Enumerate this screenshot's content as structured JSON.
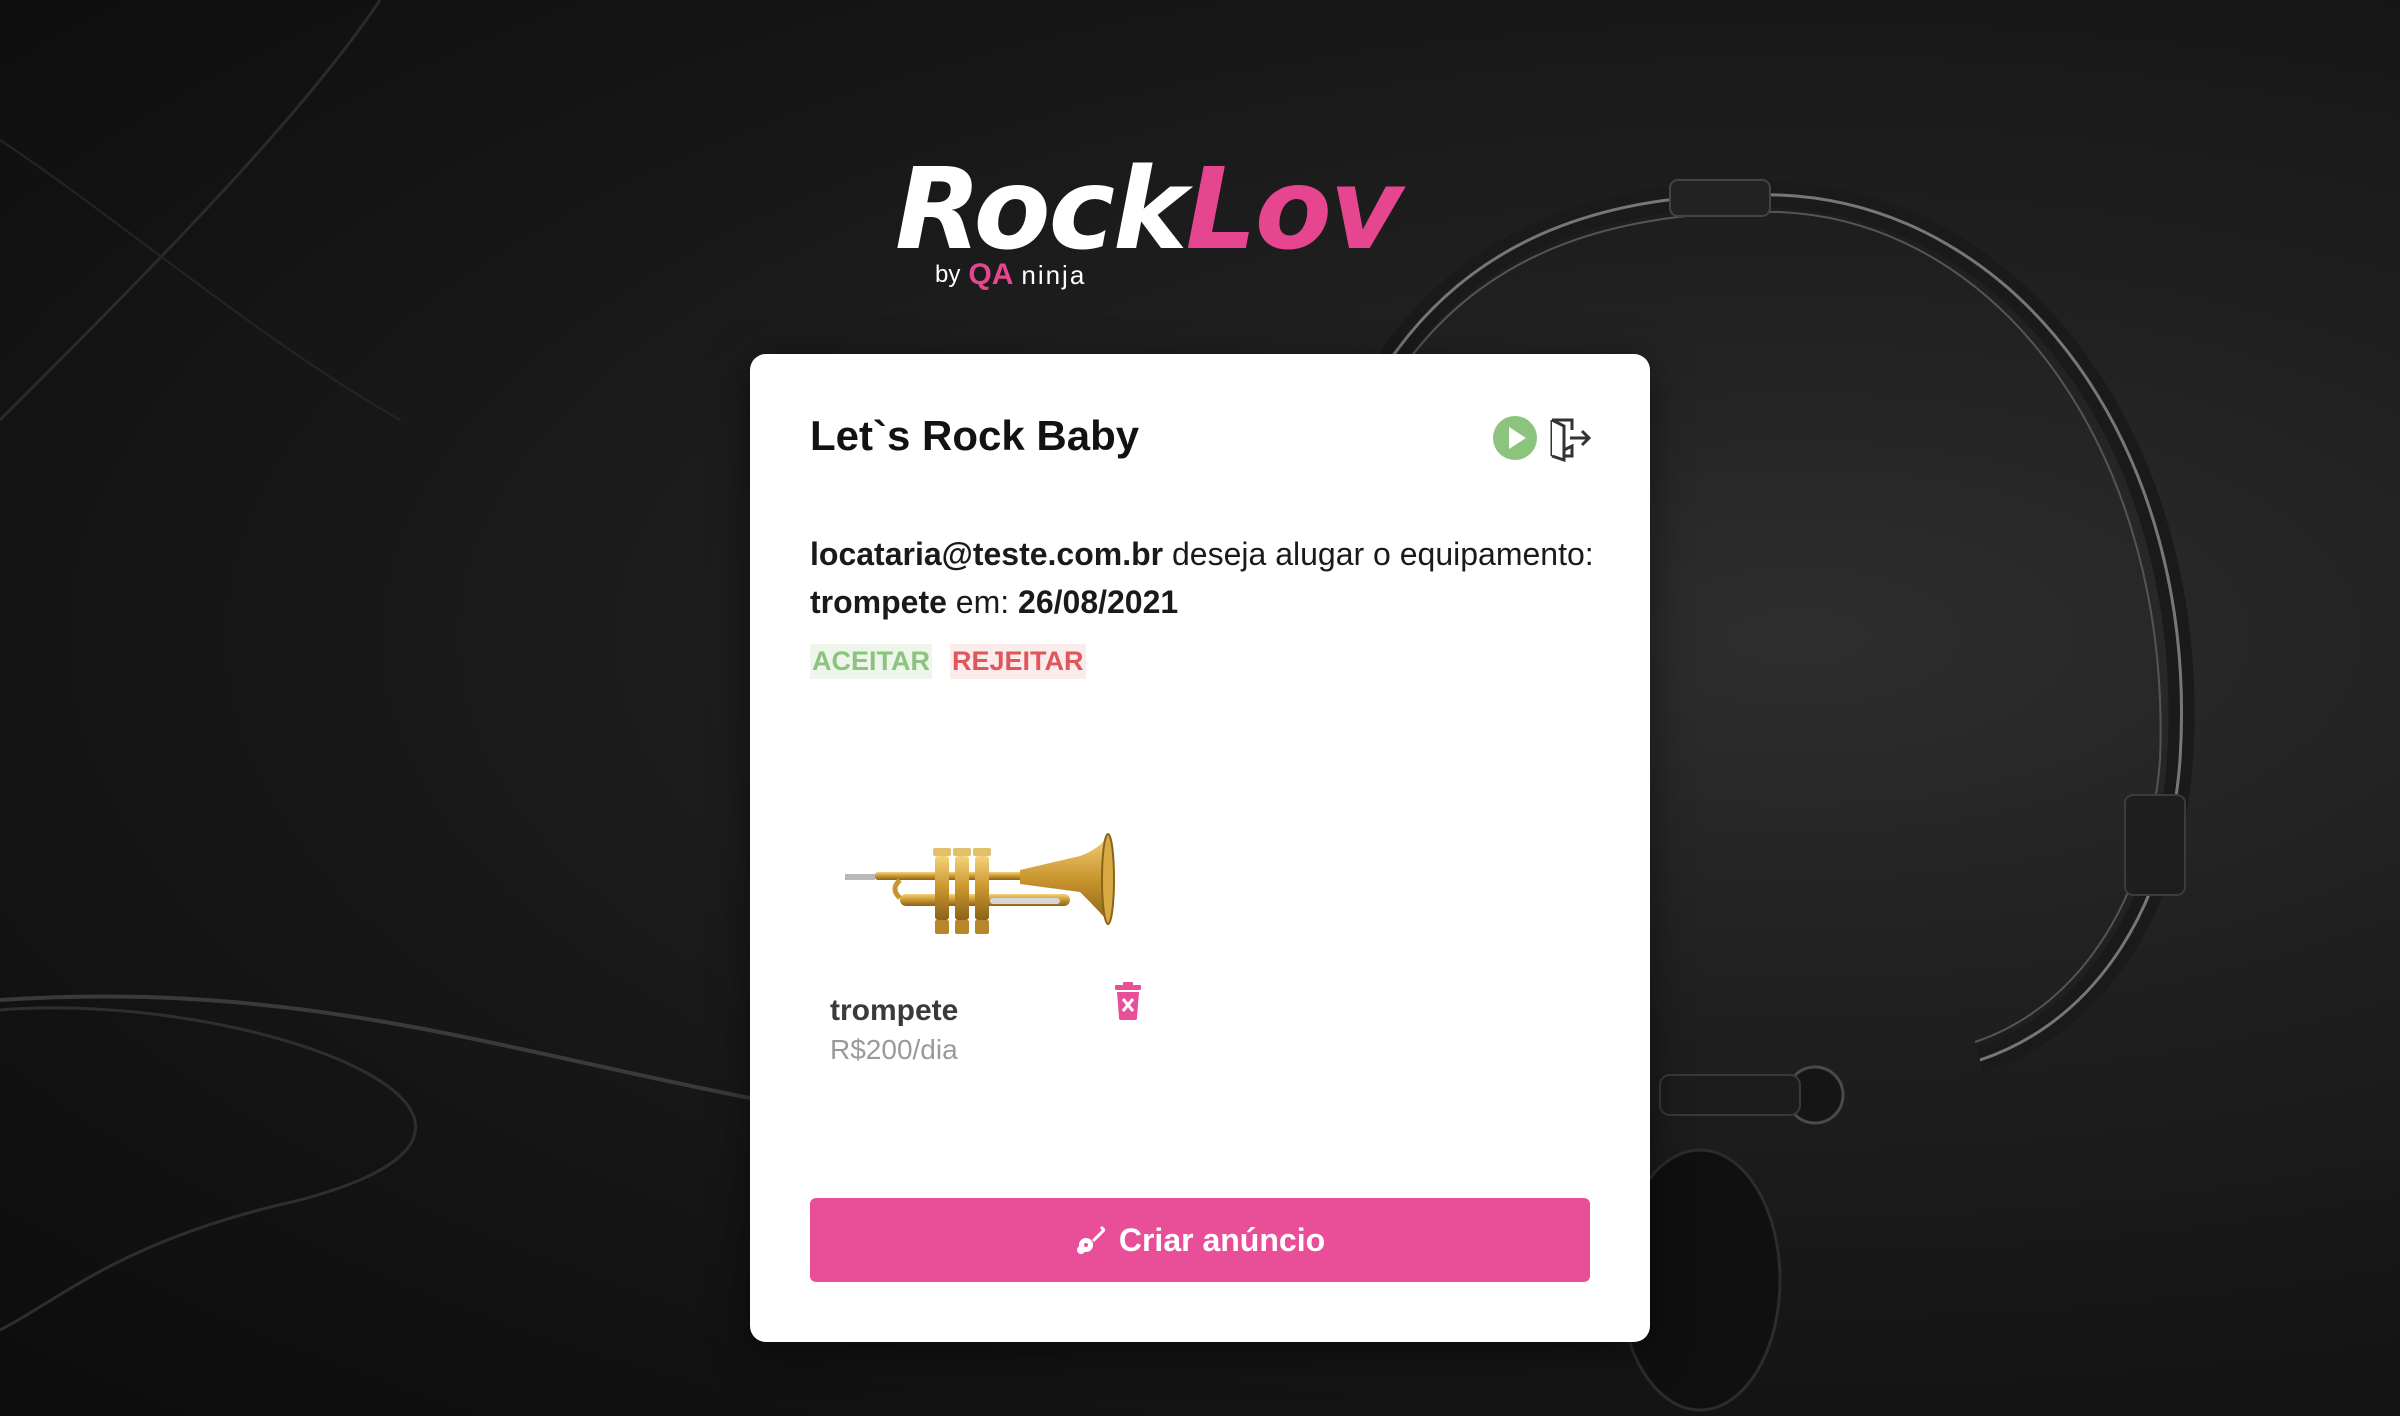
{
  "brand": {
    "logo_rock": "Rock",
    "logo_lov": "Lov",
    "by": "by",
    "qa": "QA",
    "ninja": "ninja",
    "accent_color": "#e6458f"
  },
  "card": {
    "title": "Let`s Rock Baby",
    "play_icon": "play-circle-icon",
    "logout_icon": "logout-icon"
  },
  "request": {
    "email": "locataria@teste.com.br",
    "text_1": " deseja alugar o equipamento:",
    "equipment": "trompete",
    "text_2": " em: ",
    "date": "26/08/2021"
  },
  "actions": {
    "accept": "ACEITAR",
    "reject": "REJEITAR",
    "accept_color": "#8cc47e",
    "reject_color": "#e0565b"
  },
  "equipment": {
    "name": "trompete",
    "price": "R$200/dia",
    "image_icon": "trumpet-image",
    "delete_icon": "trash-icon"
  },
  "create_button": {
    "label": "Criar anúncio",
    "icon": "guitar-icon",
    "color": "#e84f98"
  }
}
